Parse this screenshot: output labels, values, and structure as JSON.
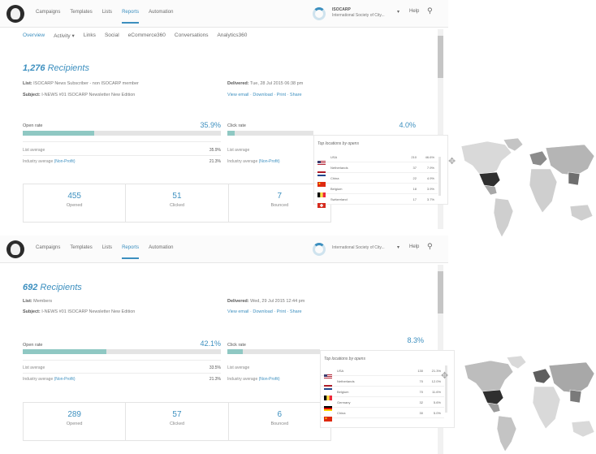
{
  "nav": {
    "links": [
      "Campaigns",
      "Templates",
      "Lists",
      "Reports",
      "Automation"
    ],
    "active": "Reports",
    "account_line1": "ISOCARP",
    "account_line2": "International Society of City...",
    "help": "Help"
  },
  "report1": {
    "subtabs": [
      "Overview",
      "Activity ▾",
      "Links",
      "Social",
      "eCommerce360",
      "Conversations",
      "Analytics360"
    ],
    "recipients_count": "1,276",
    "recipients_label": "Recipients",
    "list_label": "List:",
    "list_value": "ISOCARP News Subscriber - non ISOCARP member",
    "subject_label": "Subject:",
    "subject_value": "I-NEWS #01   ISOCARP Newsletter New Edition",
    "delivered_label": "Delivered:",
    "delivered_value": "Tue, 28 Jul 2015 06:38 pm",
    "links": "View email · Download · Print · Share",
    "open_rate_label": "Open rate",
    "open_rate": "35.9%",
    "open_rate_fraction": 0.359,
    "click_rate_label": "Click rate",
    "click_rate": "4.0%",
    "click_rate_fraction": 0.04,
    "list_avg_label": "List average",
    "list_avg_open": "35.9%",
    "industry_avg_label": "Industry average",
    "industry_avg_link": "(Non-Profit)",
    "industry_avg_open": "21.3%",
    "stats": [
      {
        "num": "455",
        "label": "Opened"
      },
      {
        "num": "51",
        "label": "Clicked"
      },
      {
        "num": "7",
        "label": "Bounced"
      },
      {
        "num": "",
        "label": ""
      }
    ],
    "locations_title": "Top locations by opens",
    "locations": [
      {
        "name": "USA",
        "count": "210",
        "pct": "46.6%",
        "flag": "us"
      },
      {
        "name": "Netherlands",
        "count": "37",
        "pct": "7.9%",
        "flag": "nl"
      },
      {
        "name": "China",
        "count": "22",
        "pct": "4.9%",
        "flag": "cn"
      },
      {
        "name": "Belgium",
        "count": "18",
        "pct": "3.9%",
        "flag": "be"
      },
      {
        "name": "Switzerland",
        "count": "17",
        "pct": "3.7%",
        "flag": "ch"
      }
    ]
  },
  "report2": {
    "recipients_count": "692",
    "recipients_label": "Recipients",
    "account_line2": "International Society of City...",
    "help": "Help",
    "list_label": "List:",
    "list_value": "Members",
    "subject_label": "Subject:",
    "subject_value": "I-NEWS #01   ISOCARP Newsletter New Edition",
    "delivered_label": "Delivered:",
    "delivered_value": "Wed, 29 Jul 2015 12:44 pm",
    "links": "View email · Download · Print · Share",
    "open_rate_label": "Open rate",
    "open_rate": "42.1%",
    "open_rate_fraction": 0.421,
    "click_rate_label": "Click rate",
    "click_rate": "8.3%",
    "click_rate_fraction": 0.083,
    "list_avg_label": "List average",
    "list_avg_open": "33.5%",
    "industry_avg_label": "Industry average",
    "industry_avg_link": "(Non-Profit)",
    "industry_avg_open": "21.3%",
    "stats": [
      {
        "num": "289",
        "label": "Opened"
      },
      {
        "num": "57",
        "label": "Clicked"
      },
      {
        "num": "6",
        "label": "Bounced"
      },
      {
        "num": "",
        "label": ""
      }
    ],
    "locations_title": "Top locations by opens",
    "locations": [
      {
        "name": "USA",
        "count": "130",
        "pct": "21.3%",
        "flag": "us"
      },
      {
        "name": "Netherlands",
        "count": "70",
        "pct": "12.0%",
        "flag": "nl"
      },
      {
        "name": "Belgium",
        "count": "70",
        "pct": "11.6%",
        "flag": "be"
      },
      {
        "name": "Germany",
        "count": "32",
        "pct": "5.6%",
        "flag": "de"
      },
      {
        "name": "China",
        "count": "30",
        "pct": "5.0%",
        "flag": "cn"
      }
    ]
  },
  "colors": {
    "accent": "#3c8fbf",
    "bar_fill": "#8fc8c3",
    "bar_track": "#e4e4e4"
  },
  "icons": {
    "logo": "mailchimp-logo",
    "account": "account-ring-icon",
    "search": "search-icon",
    "move": "move-arrows-icon",
    "map": "world-map"
  }
}
